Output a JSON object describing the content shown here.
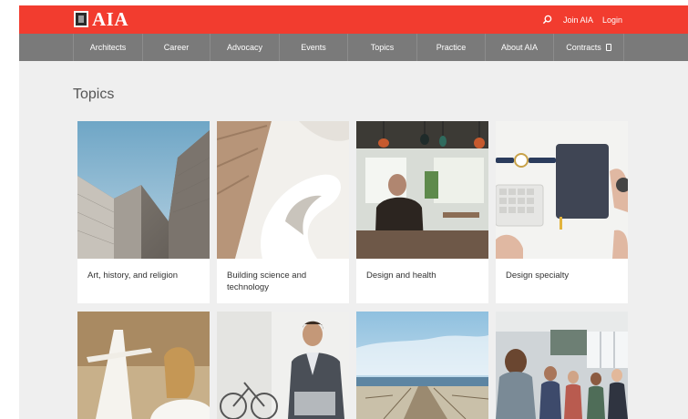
{
  "header": {
    "logo_text": "AIA",
    "join_label": "Join AIA",
    "login_label": "Login"
  },
  "nav": {
    "items": [
      {
        "label": "Architects"
      },
      {
        "label": "Career"
      },
      {
        "label": "Advocacy"
      },
      {
        "label": "Events"
      },
      {
        "label": "Topics"
      },
      {
        "label": "Practice"
      },
      {
        "label": "About AIA"
      },
      {
        "label": "Contracts"
      }
    ]
  },
  "main": {
    "title": "Topics",
    "cards": [
      {
        "label": "Art, history, and religion"
      },
      {
        "label": "Building science and technology"
      },
      {
        "label": "Design and health"
      },
      {
        "label": "Design specialty"
      },
      {
        "label": ""
      },
      {
        "label": ""
      },
      {
        "label": ""
      },
      {
        "label": ""
      }
    ]
  },
  "colors": {
    "topbar": "#f23c2f",
    "navbar": "#7a7a7a",
    "background": "#efefef"
  }
}
